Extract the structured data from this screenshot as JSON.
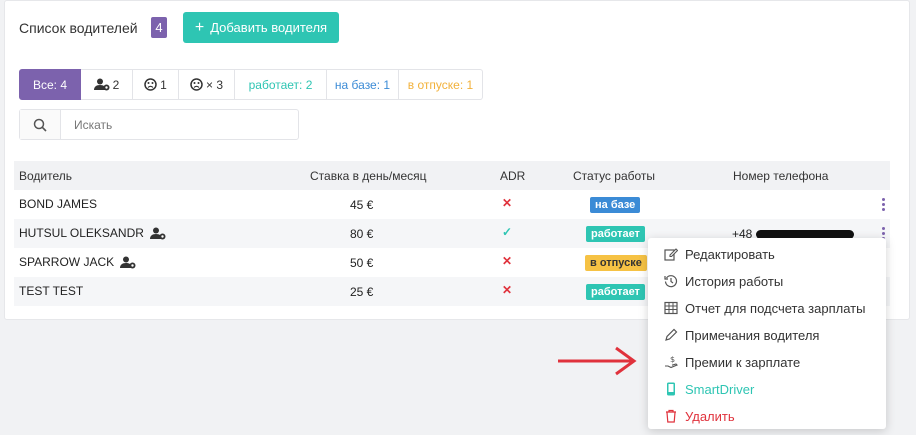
{
  "header": {
    "title": "Список водителей",
    "count": "4",
    "add_button": "Добавить водителя",
    "add_plus": "+"
  },
  "filters": [
    {
      "label": "Все: 4"
    },
    {
      "label": "2",
      "icon": "driver-icon"
    },
    {
      "label": "1",
      "icon": "sad-face-icon"
    },
    {
      "label": "× 3",
      "icon": "sad-face-icon"
    },
    {
      "label": "работает: 2"
    },
    {
      "label": "на базе: 1"
    },
    {
      "label": "в отпуске: 1"
    }
  ],
  "search": {
    "placeholder": "Искать"
  },
  "table": {
    "columns": [
      "Водитель",
      "Ставка в день/месяц",
      "ADR",
      "Статус работы",
      "Номер телефона"
    ],
    "rows": [
      {
        "name": "BOND JAMES",
        "rate": "45 €",
        "adr": "✕",
        "status": "на базе",
        "phone": ""
      },
      {
        "name": "HUTSUL OLEKSANDR",
        "rate": "80 €",
        "adr": "✓",
        "status": "работает",
        "phone": "+48"
      },
      {
        "name": "SPARROW JACK",
        "rate": "50 €",
        "adr": "✕",
        "status": "в отпуске",
        "phone": ""
      },
      {
        "name": "TEST TEST",
        "rate": "25 €",
        "adr": "✕",
        "status": "работает",
        "phone": ""
      }
    ]
  },
  "menu": {
    "items": [
      {
        "label": "Редактировать",
        "icon": "edit-icon"
      },
      {
        "label": "История работы",
        "icon": "history-icon"
      },
      {
        "label": "Отчет для подсчета зарплаты",
        "icon": "table-icon"
      },
      {
        "label": "Примечания водителя",
        "icon": "pencil-icon"
      },
      {
        "label": "Премии к зарплате",
        "icon": "bonus-hand-icon"
      },
      {
        "label": "SmartDriver",
        "icon": "phone-icon"
      },
      {
        "label": "Удалить",
        "icon": "trash-icon"
      }
    ]
  },
  "colors": {
    "purple": "#7c62ad",
    "teal": "#2ec5b3",
    "blue": "#3b8bd6",
    "orange": "#f6c244",
    "red": "#e0323c"
  }
}
